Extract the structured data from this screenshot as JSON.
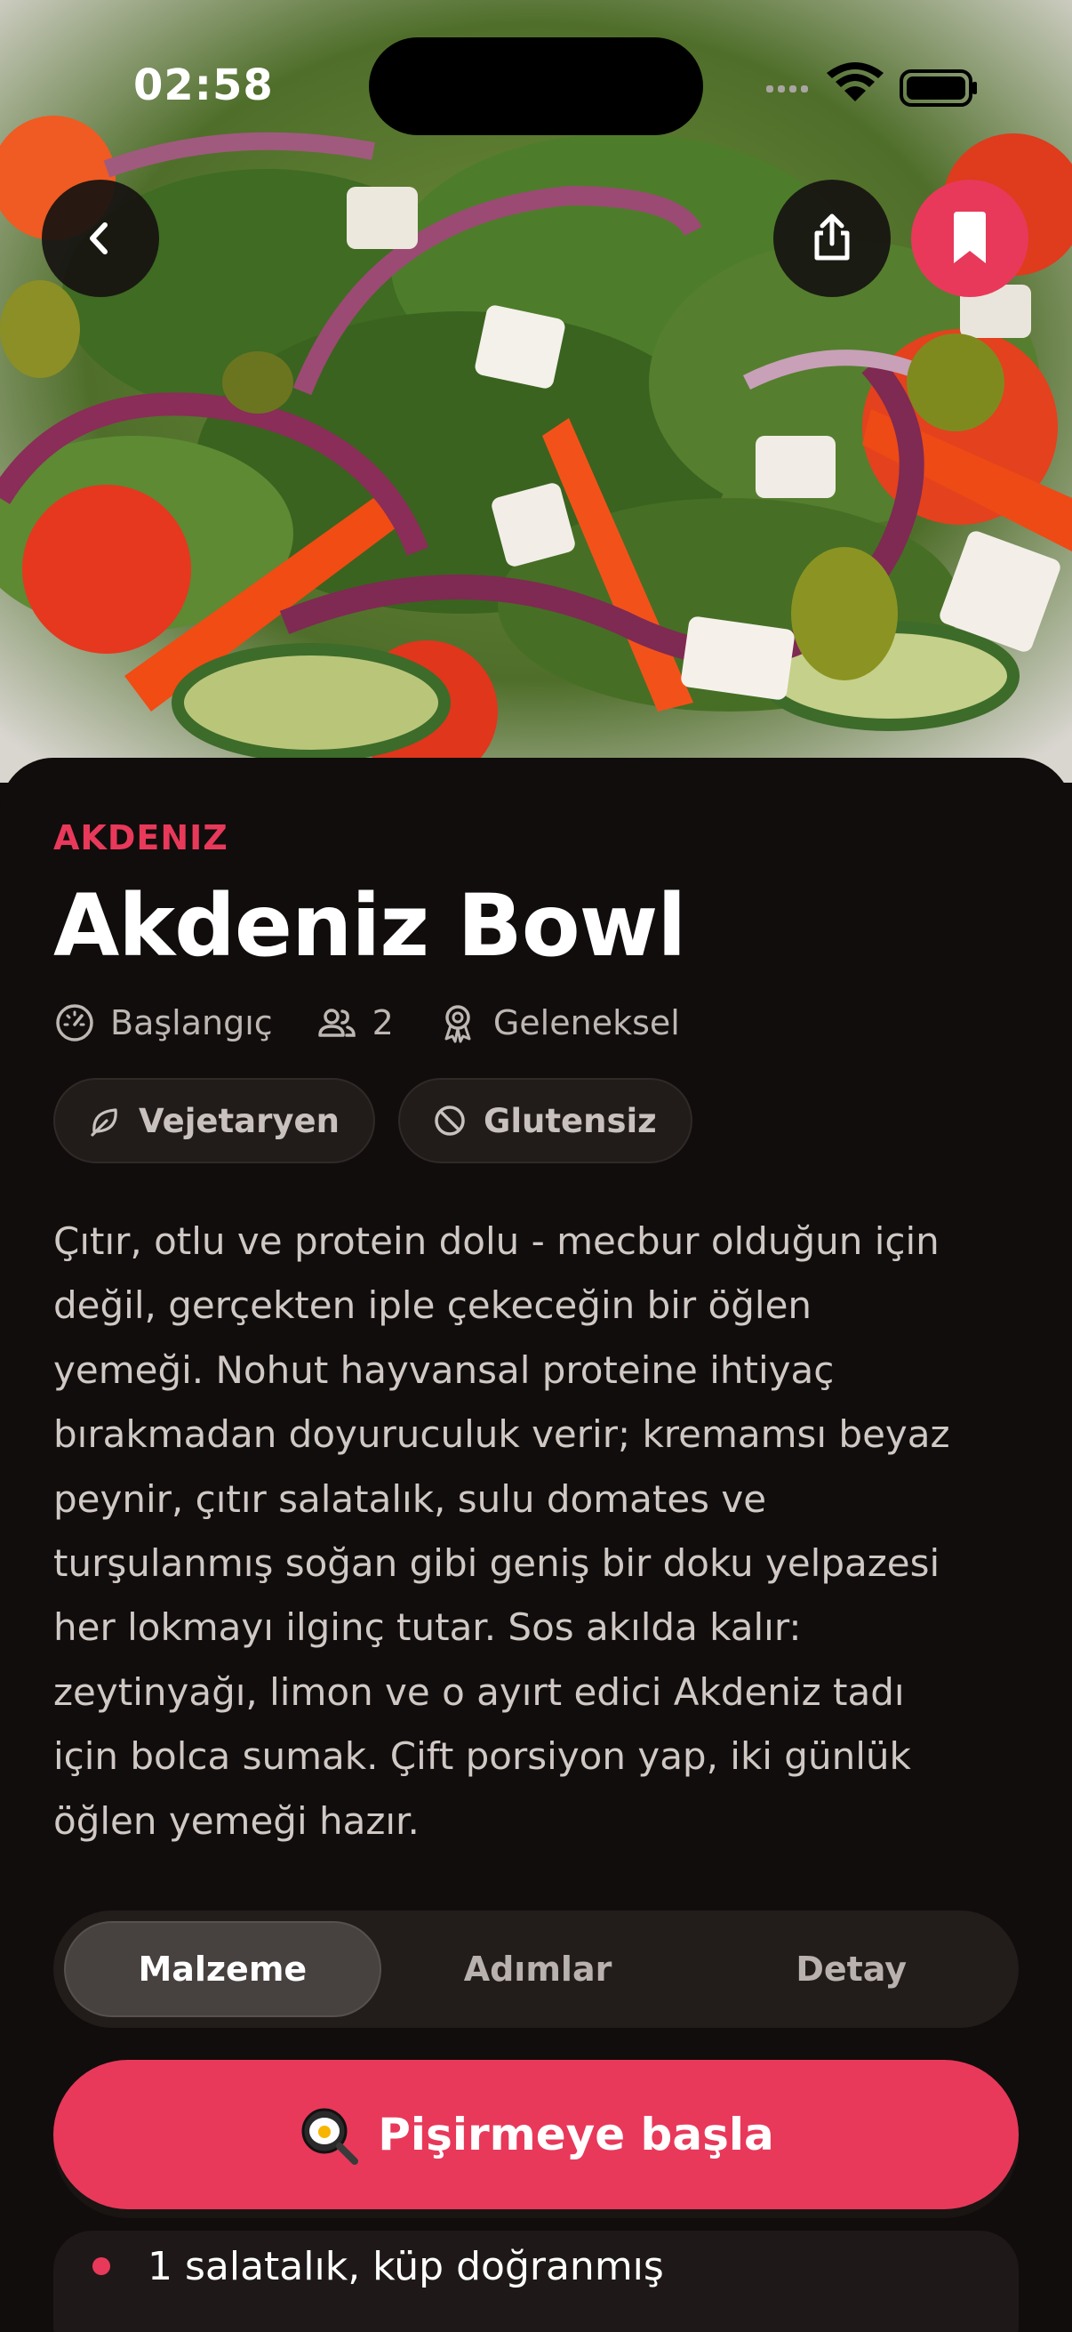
{
  "status_bar": {
    "time": "02:58"
  },
  "recipe": {
    "category": "AKDENIZ",
    "title": "Akdeniz Bowl",
    "meta": [
      {
        "icon": "gauge-icon",
        "text": "Başlangıç"
      },
      {
        "icon": "users-icon",
        "text": "2"
      },
      {
        "icon": "award-icon",
        "text": "Geleneksel"
      }
    ],
    "tags": [
      {
        "icon": "leaf-icon",
        "label": "Vejetaryen"
      },
      {
        "icon": "ban-icon",
        "label": "Glutensiz"
      }
    ],
    "description_lines": [
      "Çıtır, otlu ve protein dolu - mecbur olduğun için",
      "değil, gerçekten iple çekeceğin bir öğlen",
      "yemeği. Nohut hayvansal proteine ihtiyaç",
      "bırakmadan doyuruculuk verir; kremamsı beyaz",
      "peynir, çıtır salatalık, sulu domates ve",
      "turşulanmış soğan gibi geniş bir doku yelpazesi",
      "her lokmayı ilginç tutar. Sos akılda kalır:",
      "zeytinyağı, limon ve o ayırt edici Akdeniz tadı",
      "için bolca sumak. Çift porsiyon yap, iki günlük",
      "öğlen yemeği hazır."
    ]
  },
  "tabs": [
    {
      "label": "Malzeme",
      "active": true
    },
    {
      "label": "Adımlar",
      "active": false
    },
    {
      "label": "Detay",
      "active": false
    }
  ],
  "cta": {
    "label": "Pişirmeye başla",
    "icon": "frying-pan-icon"
  },
  "ingredients": [
    {
      "text": "1 salatalık, küp doğranmış"
    }
  ],
  "colors": {
    "accent": "#e8395a",
    "background": "#110d0c",
    "surface": "#211c1a"
  }
}
